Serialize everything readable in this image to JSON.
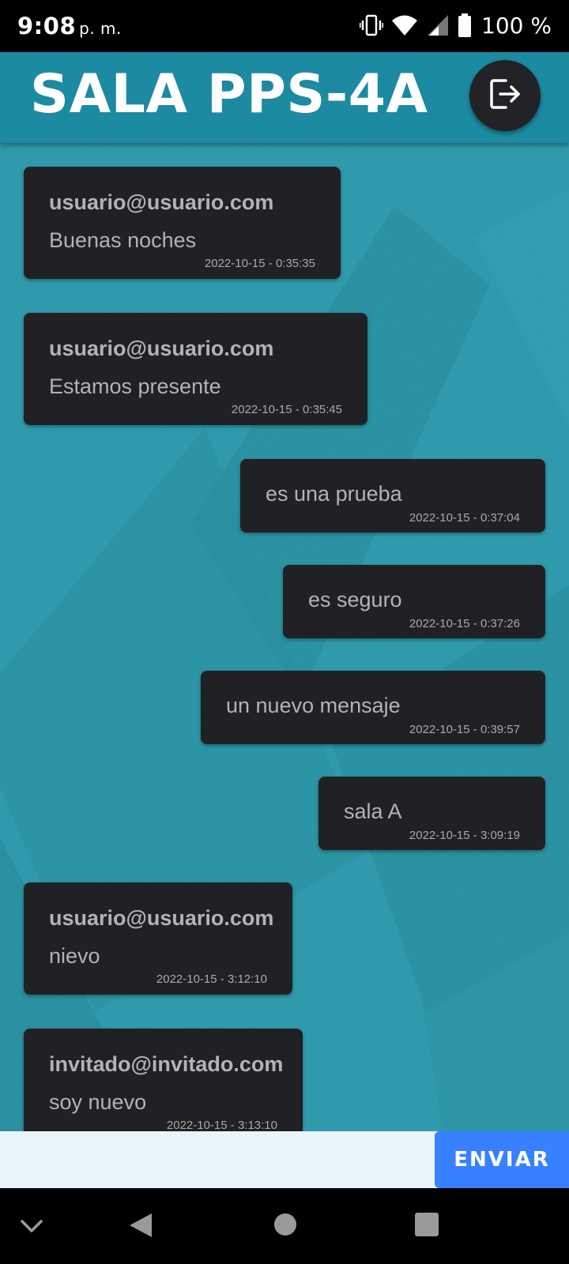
{
  "status_bar": {
    "time": "9:08",
    "ampm": "p. m.",
    "battery": "100 %"
  },
  "header": {
    "title": "SALA PPS-4A",
    "logout_icon": "logout-icon"
  },
  "colors": {
    "header": "#1c8aa1",
    "chat_background": "#2a98aa",
    "bubble": "#202124",
    "send_button": "#3880ff",
    "input_background": "#e9f5fb"
  },
  "messages": [
    {
      "sender": "usuario@usuario.com",
      "text": "Buenas noches",
      "time": "2022-10-15 - 0:35:35",
      "side": "left"
    },
    {
      "sender": "usuario@usuario.com",
      "text": "Estamos presente",
      "time": "2022-10-15 - 0:35:45",
      "side": "left"
    },
    {
      "sender": "",
      "text": "es una prueba",
      "time": "2022-10-15 - 0:37:04",
      "side": "right"
    },
    {
      "sender": "",
      "text": "es seguro",
      "time": "2022-10-15 - 0:37:26",
      "side": "right"
    },
    {
      "sender": "",
      "text": "un nuevo mensaje",
      "time": "2022-10-15 - 0:39:57",
      "side": "right"
    },
    {
      "sender": "",
      "text": "sala A",
      "time": "2022-10-15 - 3:09:19",
      "side": "right"
    },
    {
      "sender": "usuario@usuario.com",
      "text": "nievo",
      "time": "2022-10-15 - 3:12:10",
      "side": "left"
    },
    {
      "sender": "invitado@invitado.com",
      "text": "soy nuevo",
      "time": "2022-10-15 - 3:13:10",
      "side": "left"
    }
  ],
  "composer": {
    "input_value": "",
    "send_label": "ENVIAR"
  },
  "nav_bar": {
    "icons": [
      "chevron-down-icon",
      "back-icon",
      "home-icon",
      "recents-icon"
    ]
  }
}
